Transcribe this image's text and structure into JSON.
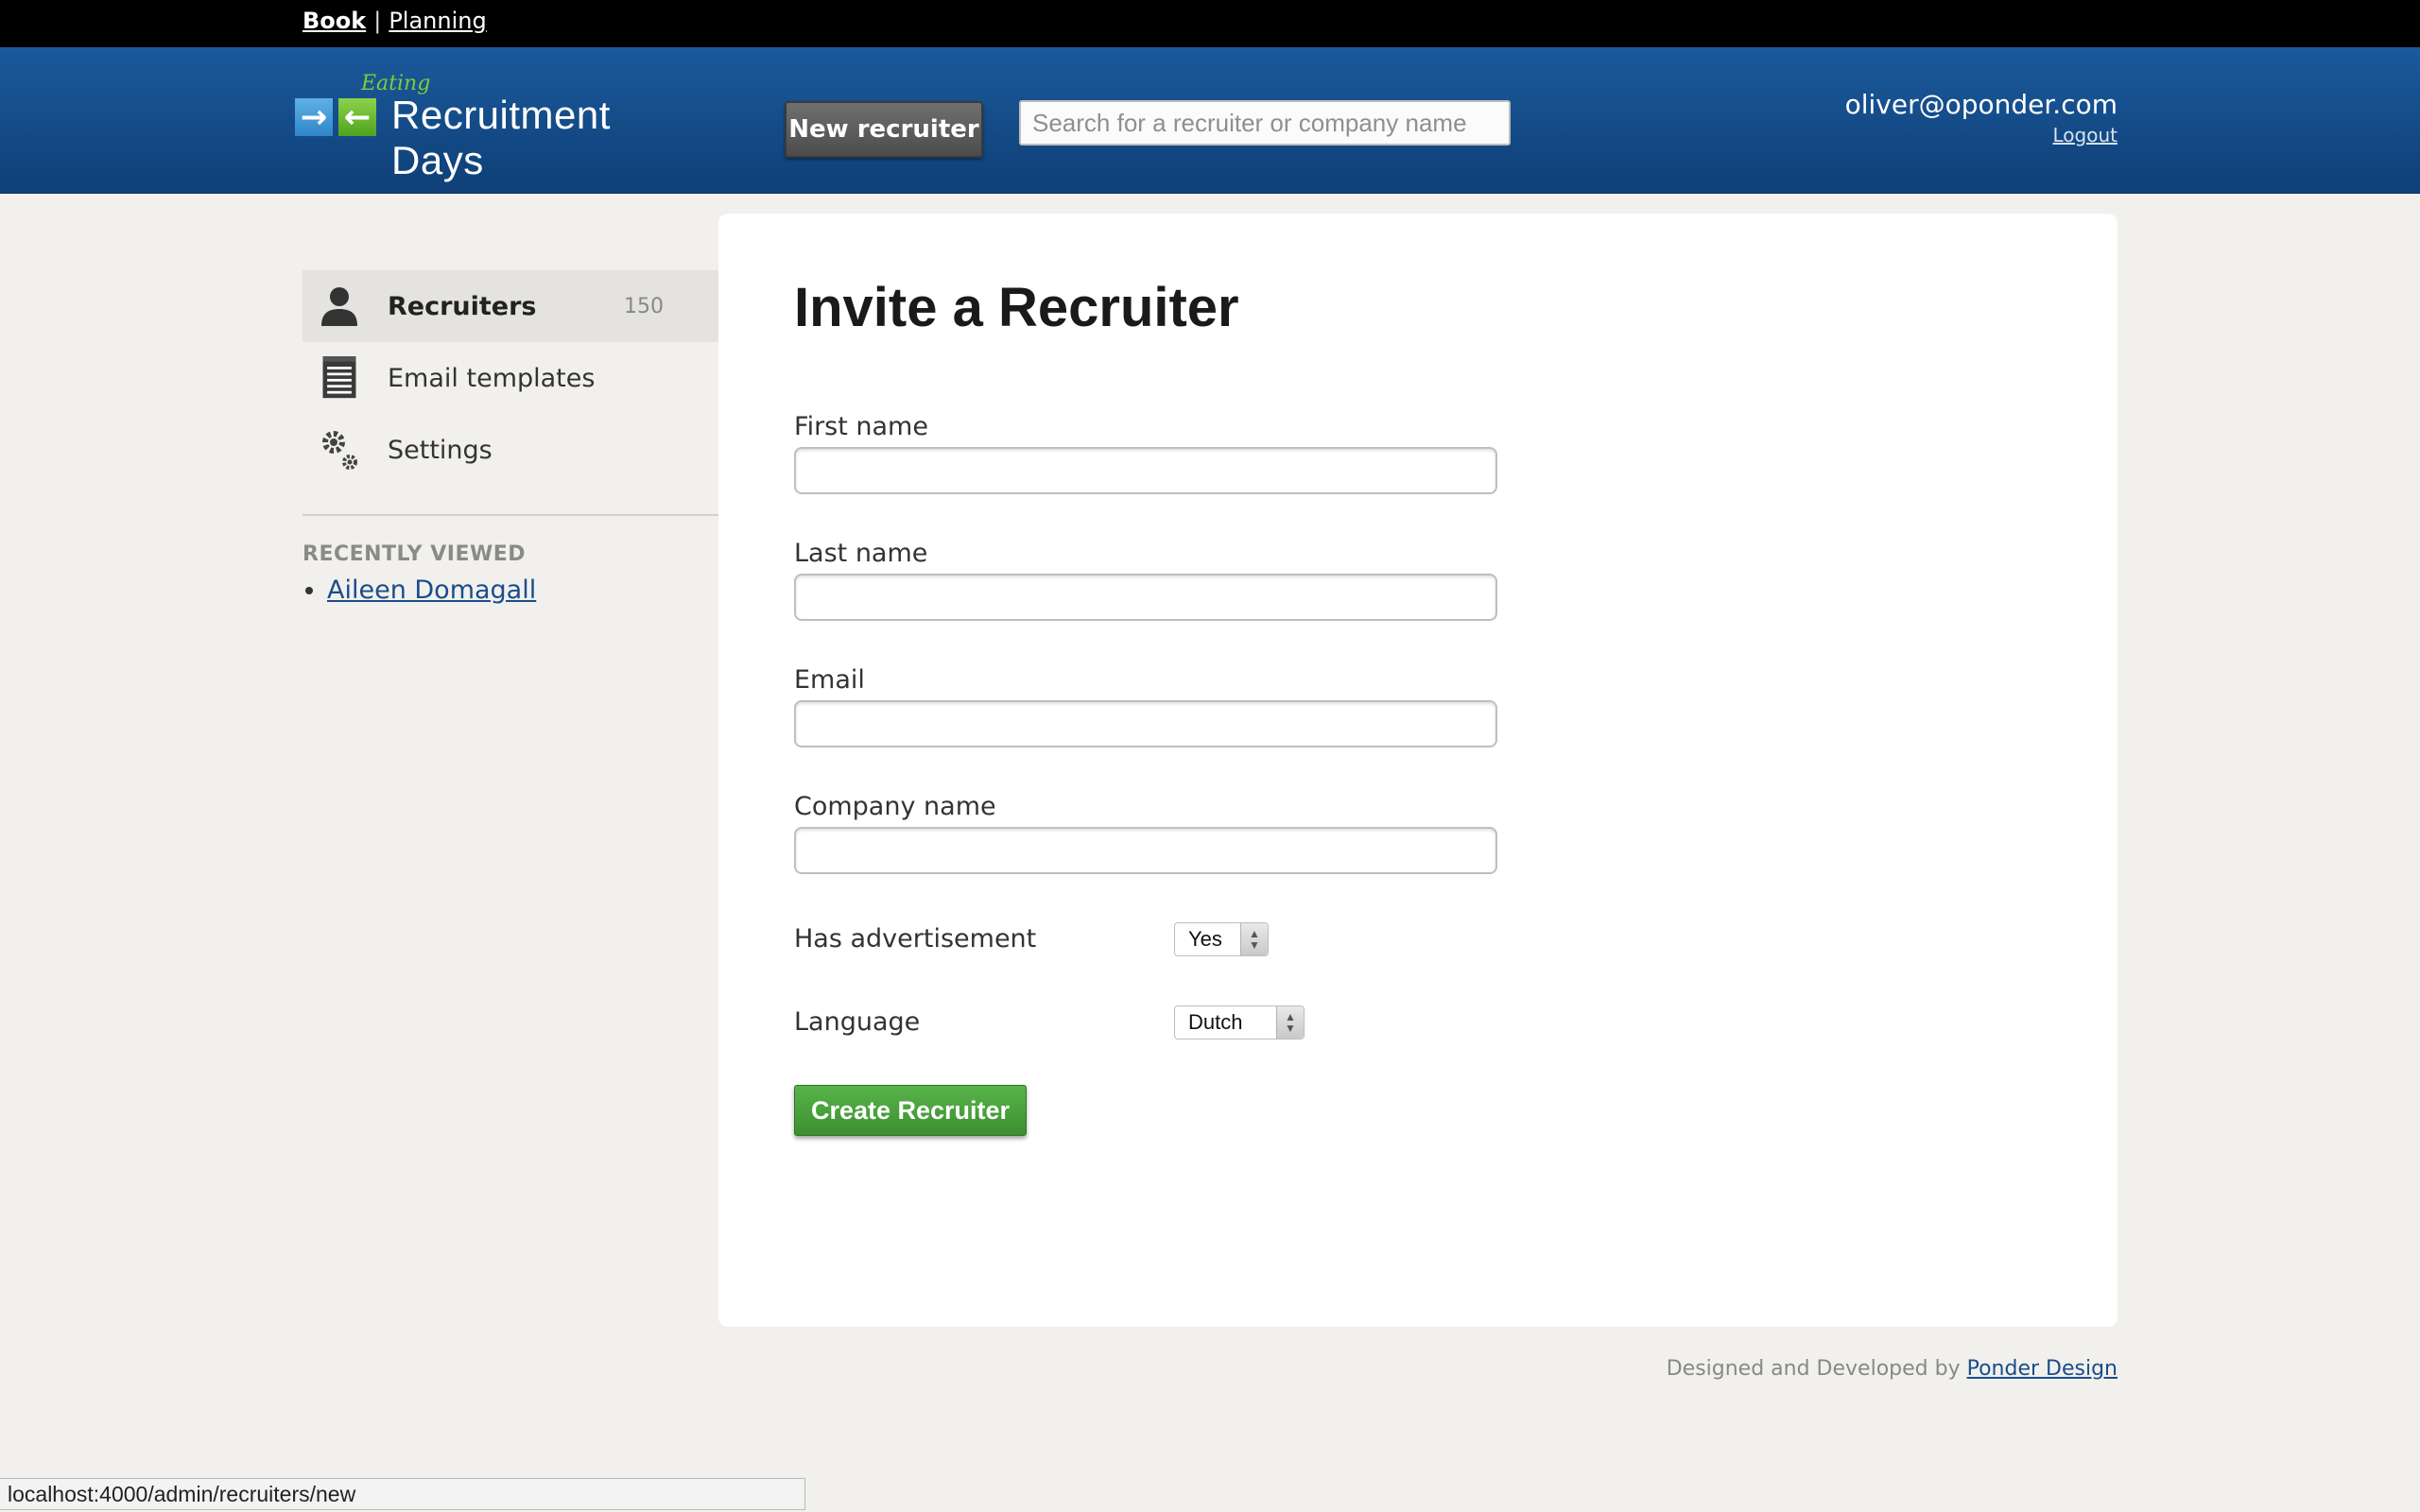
{
  "topnav": {
    "book": "Book",
    "separator": "|",
    "planning": "Planning"
  },
  "header": {
    "logo_script": "Eating",
    "logo_name": "Recruitment Days",
    "new_recruiter_label": "New recruiter",
    "search_placeholder": "Search for a recruiter or company name",
    "user_email": "oliver@oponder.com",
    "logout_label": "Logout"
  },
  "sidebar": {
    "items": [
      {
        "label": "Recruiters",
        "count": "150",
        "icon": "person-icon",
        "active": true
      },
      {
        "label": "Email templates",
        "icon": "notepad-icon"
      },
      {
        "label": "Settings",
        "icon": "gears-icon"
      }
    ],
    "recent_title": "RECENTLY VIEWED",
    "recent": [
      "Aileen Domagall"
    ]
  },
  "form": {
    "title": "Invite a Recruiter",
    "first_name_label": "First name",
    "first_name_value": "",
    "last_name_label": "Last name",
    "last_name_value": "",
    "email_label": "Email",
    "email_value": "",
    "company_label": "Company name",
    "company_value": "",
    "advert_label": "Has advertisement",
    "advert_value": "Yes",
    "language_label": "Language",
    "language_value": "Dutch",
    "submit_label": "Create Recruiter"
  },
  "footer": {
    "text": "Designed and Developed by",
    "link": "Ponder Design"
  },
  "statusbar": {
    "url": "localhost:4000/admin/recruiters/new"
  },
  "colors": {
    "header_blue": "#134a86",
    "submit_green": "#3c8f2f",
    "link_blue": "#1a4d8c"
  }
}
